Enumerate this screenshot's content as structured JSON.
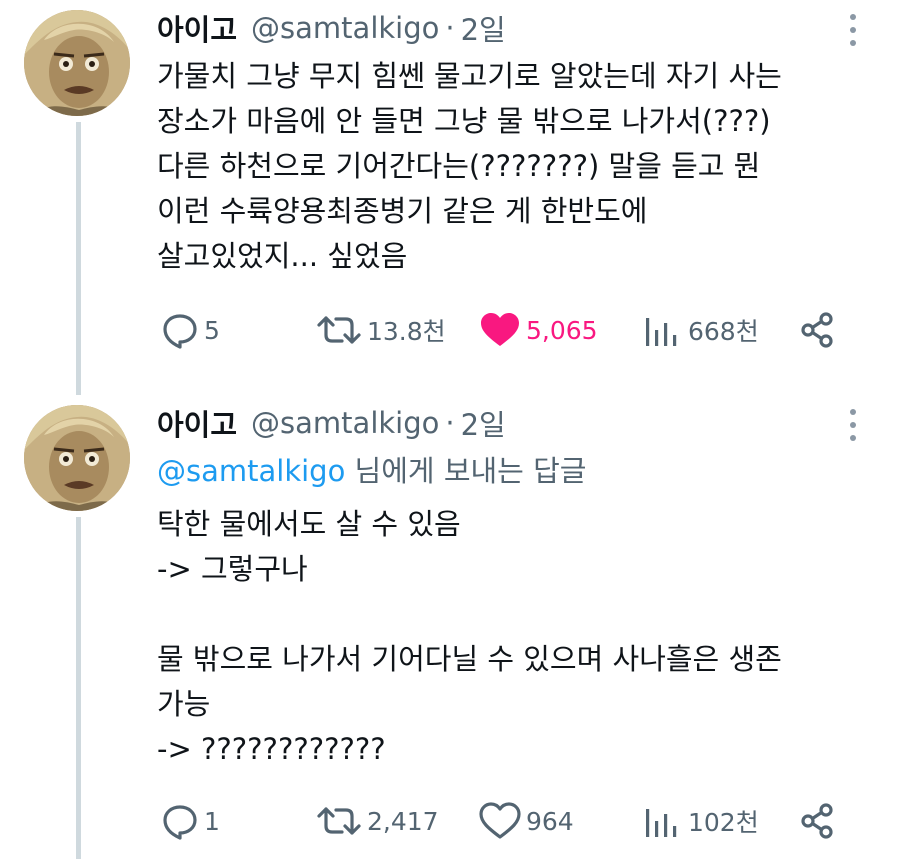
{
  "tweets": [
    {
      "author_name": "아이고",
      "handle": "@samtalkigo",
      "separator": "·",
      "time": "2일",
      "avatar_icon": "avatar-image",
      "lines": [
        "가물치 그냥 무지 힘쎈 물고기로 알았는데 자기 사는",
        "장소가 마음에 안 들면 그냥 물 밖으로 나가서(???)",
        "다른 하천으로 기어간다는(???????) 말을 듣고 뭔",
        "이런 수륙양용최종병기 같은 게 한반도에",
        "살고있었지... 싶었음"
      ],
      "actions": {
        "replies": "5",
        "retweets": "13.8천",
        "likes": "5,065",
        "views": "668천"
      },
      "liked": true
    },
    {
      "author_name": "아이고",
      "handle": "@samtalkigo",
      "separator": "·",
      "time": "2일",
      "avatar_icon": "avatar-image",
      "reply_mention": "@samtalkigo",
      "reply_suffix": " 님에게 보내는 답글",
      "lines": [
        "탁한 물에서도 살 수 있음",
        "-> 그렇구나",
        "",
        "물 밖으로 나가서 기어다닐 수 있으며 사나흘은 생존",
        "가능",
        "-> ????????????"
      ],
      "actions": {
        "replies": "1",
        "retweets": "2,417",
        "likes": "964",
        "views": "102천"
      },
      "liked": false
    }
  ],
  "colors": {
    "text": "#0f1419",
    "secondary": "#536471",
    "link": "#1d9bf0",
    "like": "#f91880",
    "thread_line": "#cfd9de"
  }
}
